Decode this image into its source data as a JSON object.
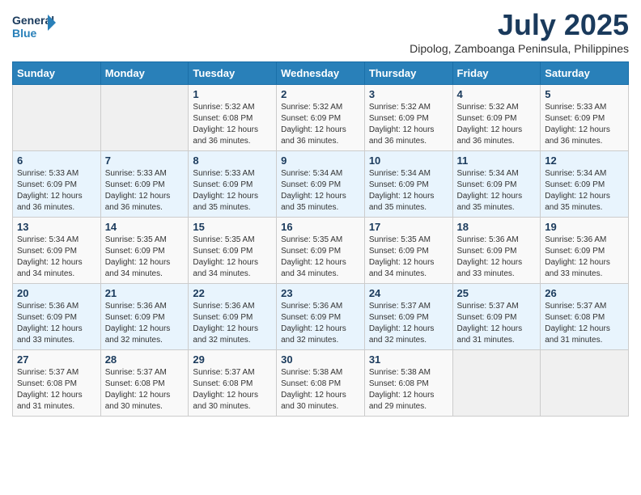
{
  "header": {
    "logo_line1": "General",
    "logo_line2": "Blue",
    "title": "July 2025",
    "subtitle": "Dipolog, Zamboanga Peninsula, Philippines"
  },
  "weekdays": [
    "Sunday",
    "Monday",
    "Tuesday",
    "Wednesday",
    "Thursday",
    "Friday",
    "Saturday"
  ],
  "weeks": [
    [
      {
        "day": "",
        "info": ""
      },
      {
        "day": "",
        "info": ""
      },
      {
        "day": "1",
        "info": "Sunrise: 5:32 AM\nSunset: 6:08 PM\nDaylight: 12 hours and 36 minutes."
      },
      {
        "day": "2",
        "info": "Sunrise: 5:32 AM\nSunset: 6:09 PM\nDaylight: 12 hours and 36 minutes."
      },
      {
        "day": "3",
        "info": "Sunrise: 5:32 AM\nSunset: 6:09 PM\nDaylight: 12 hours and 36 minutes."
      },
      {
        "day": "4",
        "info": "Sunrise: 5:32 AM\nSunset: 6:09 PM\nDaylight: 12 hours and 36 minutes."
      },
      {
        "day": "5",
        "info": "Sunrise: 5:33 AM\nSunset: 6:09 PM\nDaylight: 12 hours and 36 minutes."
      }
    ],
    [
      {
        "day": "6",
        "info": "Sunrise: 5:33 AM\nSunset: 6:09 PM\nDaylight: 12 hours and 36 minutes."
      },
      {
        "day": "7",
        "info": "Sunrise: 5:33 AM\nSunset: 6:09 PM\nDaylight: 12 hours and 36 minutes."
      },
      {
        "day": "8",
        "info": "Sunrise: 5:33 AM\nSunset: 6:09 PM\nDaylight: 12 hours and 35 minutes."
      },
      {
        "day": "9",
        "info": "Sunrise: 5:34 AM\nSunset: 6:09 PM\nDaylight: 12 hours and 35 minutes."
      },
      {
        "day": "10",
        "info": "Sunrise: 5:34 AM\nSunset: 6:09 PM\nDaylight: 12 hours and 35 minutes."
      },
      {
        "day": "11",
        "info": "Sunrise: 5:34 AM\nSunset: 6:09 PM\nDaylight: 12 hours and 35 minutes."
      },
      {
        "day": "12",
        "info": "Sunrise: 5:34 AM\nSunset: 6:09 PM\nDaylight: 12 hours and 35 minutes."
      }
    ],
    [
      {
        "day": "13",
        "info": "Sunrise: 5:34 AM\nSunset: 6:09 PM\nDaylight: 12 hours and 34 minutes."
      },
      {
        "day": "14",
        "info": "Sunrise: 5:35 AM\nSunset: 6:09 PM\nDaylight: 12 hours and 34 minutes."
      },
      {
        "day": "15",
        "info": "Sunrise: 5:35 AM\nSunset: 6:09 PM\nDaylight: 12 hours and 34 minutes."
      },
      {
        "day": "16",
        "info": "Sunrise: 5:35 AM\nSunset: 6:09 PM\nDaylight: 12 hours and 34 minutes."
      },
      {
        "day": "17",
        "info": "Sunrise: 5:35 AM\nSunset: 6:09 PM\nDaylight: 12 hours and 34 minutes."
      },
      {
        "day": "18",
        "info": "Sunrise: 5:36 AM\nSunset: 6:09 PM\nDaylight: 12 hours and 33 minutes."
      },
      {
        "day": "19",
        "info": "Sunrise: 5:36 AM\nSunset: 6:09 PM\nDaylight: 12 hours and 33 minutes."
      }
    ],
    [
      {
        "day": "20",
        "info": "Sunrise: 5:36 AM\nSunset: 6:09 PM\nDaylight: 12 hours and 33 minutes."
      },
      {
        "day": "21",
        "info": "Sunrise: 5:36 AM\nSunset: 6:09 PM\nDaylight: 12 hours and 32 minutes."
      },
      {
        "day": "22",
        "info": "Sunrise: 5:36 AM\nSunset: 6:09 PM\nDaylight: 12 hours and 32 minutes."
      },
      {
        "day": "23",
        "info": "Sunrise: 5:36 AM\nSunset: 6:09 PM\nDaylight: 12 hours and 32 minutes."
      },
      {
        "day": "24",
        "info": "Sunrise: 5:37 AM\nSunset: 6:09 PM\nDaylight: 12 hours and 32 minutes."
      },
      {
        "day": "25",
        "info": "Sunrise: 5:37 AM\nSunset: 6:09 PM\nDaylight: 12 hours and 31 minutes."
      },
      {
        "day": "26",
        "info": "Sunrise: 5:37 AM\nSunset: 6:08 PM\nDaylight: 12 hours and 31 minutes."
      }
    ],
    [
      {
        "day": "27",
        "info": "Sunrise: 5:37 AM\nSunset: 6:08 PM\nDaylight: 12 hours and 31 minutes."
      },
      {
        "day": "28",
        "info": "Sunrise: 5:37 AM\nSunset: 6:08 PM\nDaylight: 12 hours and 30 minutes."
      },
      {
        "day": "29",
        "info": "Sunrise: 5:37 AM\nSunset: 6:08 PM\nDaylight: 12 hours and 30 minutes."
      },
      {
        "day": "30",
        "info": "Sunrise: 5:38 AM\nSunset: 6:08 PM\nDaylight: 12 hours and 30 minutes."
      },
      {
        "day": "31",
        "info": "Sunrise: 5:38 AM\nSunset: 6:08 PM\nDaylight: 12 hours and 29 minutes."
      },
      {
        "day": "",
        "info": ""
      },
      {
        "day": "",
        "info": ""
      }
    ]
  ]
}
